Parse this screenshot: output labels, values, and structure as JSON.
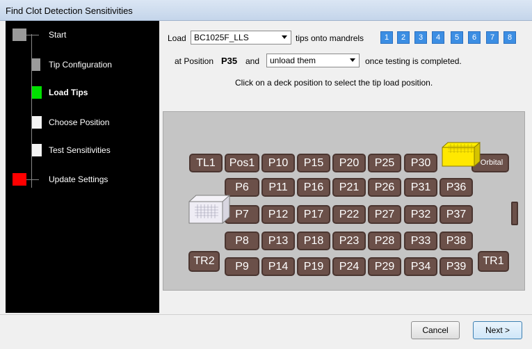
{
  "window": {
    "title": "Find Clot Detection Sensitivities"
  },
  "wizard": {
    "steps": [
      {
        "label": "Start",
        "color": "#9a9a9a",
        "active": false
      },
      {
        "label": "Tip Configuration",
        "color": "#9a9a9a",
        "active": false
      },
      {
        "label": "Load Tips",
        "color": "#00e000",
        "active": true
      },
      {
        "label": "Choose Position",
        "color": "#f4f4f4",
        "active": false
      },
      {
        "label": "Test Sensitivities",
        "color": "#f4f4f4",
        "active": false
      },
      {
        "label": "Update Settings",
        "color": "#ff0000",
        "active": false
      }
    ]
  },
  "load": {
    "load_label": "Load",
    "tip_type": "BC1025F_LLS",
    "mandrels_label": "tips onto mandrels",
    "mandrels": [
      "1",
      "2",
      "3",
      "4",
      "5",
      "6",
      "7",
      "8"
    ],
    "at_position_label": "at Position",
    "position": "P35",
    "and_label": "and",
    "unload_option": "unload them",
    "completed_label": "once testing is completed.",
    "instruction": "Click on a deck position to select the tip load position."
  },
  "deck": {
    "row1": [
      "TL1",
      "Pos1",
      "P10",
      "P15",
      "P20",
      "P25",
      "P30",
      "Orbital"
    ],
    "row2": [
      "P6",
      "P11",
      "P16",
      "P21",
      "P26",
      "P31",
      "P36"
    ],
    "row3": [
      "P7",
      "P12",
      "P17",
      "P22",
      "P27",
      "P32",
      "P37"
    ],
    "row4": [
      "P8",
      "P13",
      "P18",
      "P23",
      "P28",
      "P33",
      "P38"
    ],
    "row5": [
      "P9",
      "P14",
      "P19",
      "P24",
      "P29",
      "P34",
      "P39"
    ],
    "tr2": "TR2",
    "tr1": "TR1"
  },
  "buttons": {
    "cancel": "Cancel",
    "next": "Next >"
  },
  "colors": {
    "deck_position": "#6b5049",
    "mandrel": "#3c8ee3",
    "plate_yellow": "#ffee00"
  }
}
